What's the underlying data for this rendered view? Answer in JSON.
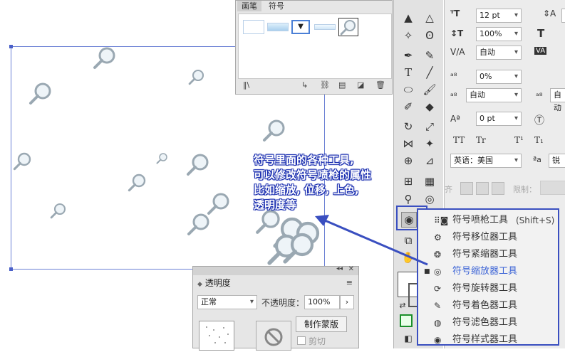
{
  "symbols_panel": {
    "tabs": [
      "画笔",
      "符号"
    ],
    "active_tab": "符号",
    "footer_icons": [
      "symbol-library-icon",
      "place-symbol-icon",
      "break-link-icon",
      "symbol-options-icon",
      "new-symbol-icon",
      "delete-symbol-icon"
    ]
  },
  "character_panel": {
    "font_size": "12 pt",
    "leading": "100%",
    "leading_label": "自动",
    "horizontal_scale": "0%",
    "kerning_label": "自动",
    "tracking_label": "自动",
    "baseline_shift": "0 pt",
    "tt_label": "TT",
    "tr_label": "Tr",
    "t1_label": "T¹",
    "t2_label": "T₁",
    "language": "英语：美国",
    "aa_label": "ªa",
    "aa_value": "锐",
    "align_label": "齐",
    "control_label": "限制："
  },
  "transparency_panel": {
    "title": "透明度",
    "blend_mode": "正常",
    "opacity_label": "不透明度：",
    "opacity_value": "100%",
    "make_mask_button": "制作蒙版",
    "clip_label": "剪切"
  },
  "annotation": {
    "lines": [
      "符号里面的各种工具,",
      "可以修改符号喷枪的属性",
      "比如缩放, 位移, 上色,",
      "透明度等"
    ]
  },
  "submenu": {
    "items": [
      {
        "icon": "symbol-sprayer-icon",
        "label": "符号喷枪工具",
        "shortcut": "(Shift+S)",
        "selected": false
      },
      {
        "icon": "symbol-shifter-icon",
        "label": "符号移位器工具",
        "shortcut": "",
        "selected": false
      },
      {
        "icon": "symbol-scruncher-icon",
        "label": "符号紧缩器工具",
        "shortcut": "",
        "selected": false
      },
      {
        "icon": "symbol-sizer-icon",
        "label": "符号缩放器工具",
        "shortcut": "",
        "selected": true
      },
      {
        "icon": "symbol-spinner-icon",
        "label": "符号旋转器工具",
        "shortcut": "",
        "selected": false
      },
      {
        "icon": "symbol-stainer-icon",
        "label": "符号着色器工具",
        "shortcut": "",
        "selected": false
      },
      {
        "icon": "symbol-screener-icon",
        "label": "符号滤色器工具",
        "shortcut": "",
        "selected": false
      },
      {
        "icon": "symbol-styler-icon",
        "label": "符号样式器工具",
        "shortcut": "",
        "selected": false
      }
    ]
  },
  "colors": {
    "accent": "#3b63d6",
    "annotation_outline": "#1b2fb0",
    "artboard_border": "#6a7fd4"
  }
}
